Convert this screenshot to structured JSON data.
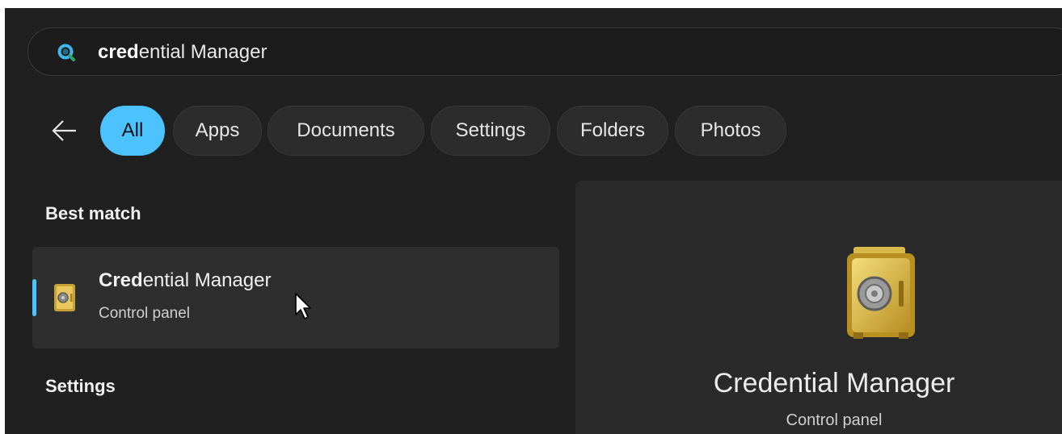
{
  "search": {
    "match_bold": "cred",
    "match_rest": "ential Manager"
  },
  "filters": [
    "All",
    "Apps",
    "Documents",
    "Settings",
    "Folders",
    "Photos"
  ],
  "active_filter": "All",
  "best_match": {
    "heading": "Best match",
    "item": {
      "title_bold": "Cred",
      "title_rest": "ential Manager",
      "subtitle": "Control panel"
    }
  },
  "settings_heading": "Settings",
  "preview": {
    "title": "Credential Manager",
    "subtitle": "Control panel"
  },
  "colors": {
    "accent": "#4cc2ff",
    "background": "#202020",
    "panel": "#2a2a2a"
  },
  "icons": {
    "search": "search-icon",
    "back": "back-arrow-icon",
    "app": "safe-icon",
    "cursor": "mouse-pointer-icon"
  }
}
